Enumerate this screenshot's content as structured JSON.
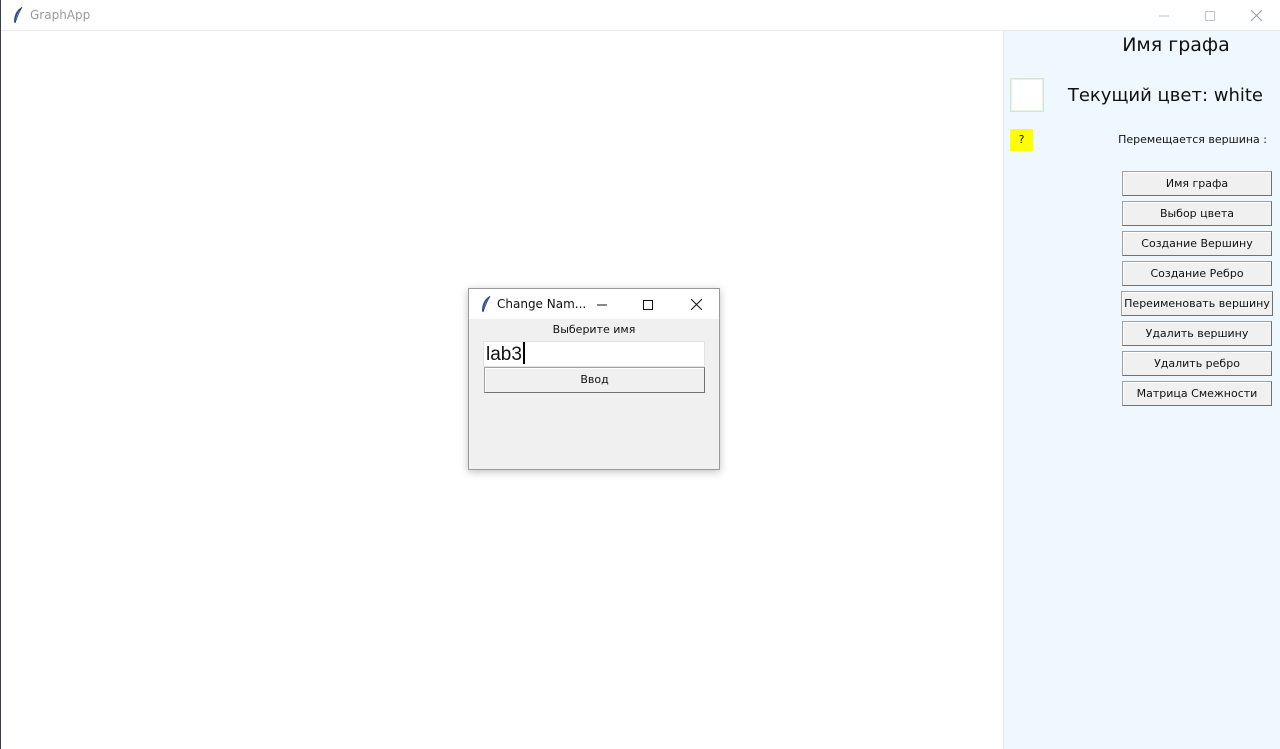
{
  "window": {
    "title": "GraphApp",
    "controls": [
      "minimize-icon",
      "maximize-icon",
      "close-icon"
    ]
  },
  "side_panel": {
    "graph_name": "Имя графа",
    "swatch_color": "#ffffff",
    "current_color_text": "Текущий цвет: white",
    "move_badge_text": "?",
    "move_badge_color": "#ffff00",
    "move_label": "Перемещается вершина :",
    "buttons": [
      {
        "label": "Имя графа"
      },
      {
        "label": "Выбор цвета"
      },
      {
        "label": "Создание Вершину"
      },
      {
        "label": "Создание Ребро"
      },
      {
        "label": "Переименовать вершину"
      },
      {
        "label": "Удалить вершину"
      },
      {
        "label": "Удалить ребро"
      },
      {
        "label": "Матрица Смежности"
      }
    ]
  },
  "dialog": {
    "title": "Change Nam...",
    "prompt": "Выберите имя",
    "input_value": "lab3",
    "submit_label": "Ввод"
  }
}
